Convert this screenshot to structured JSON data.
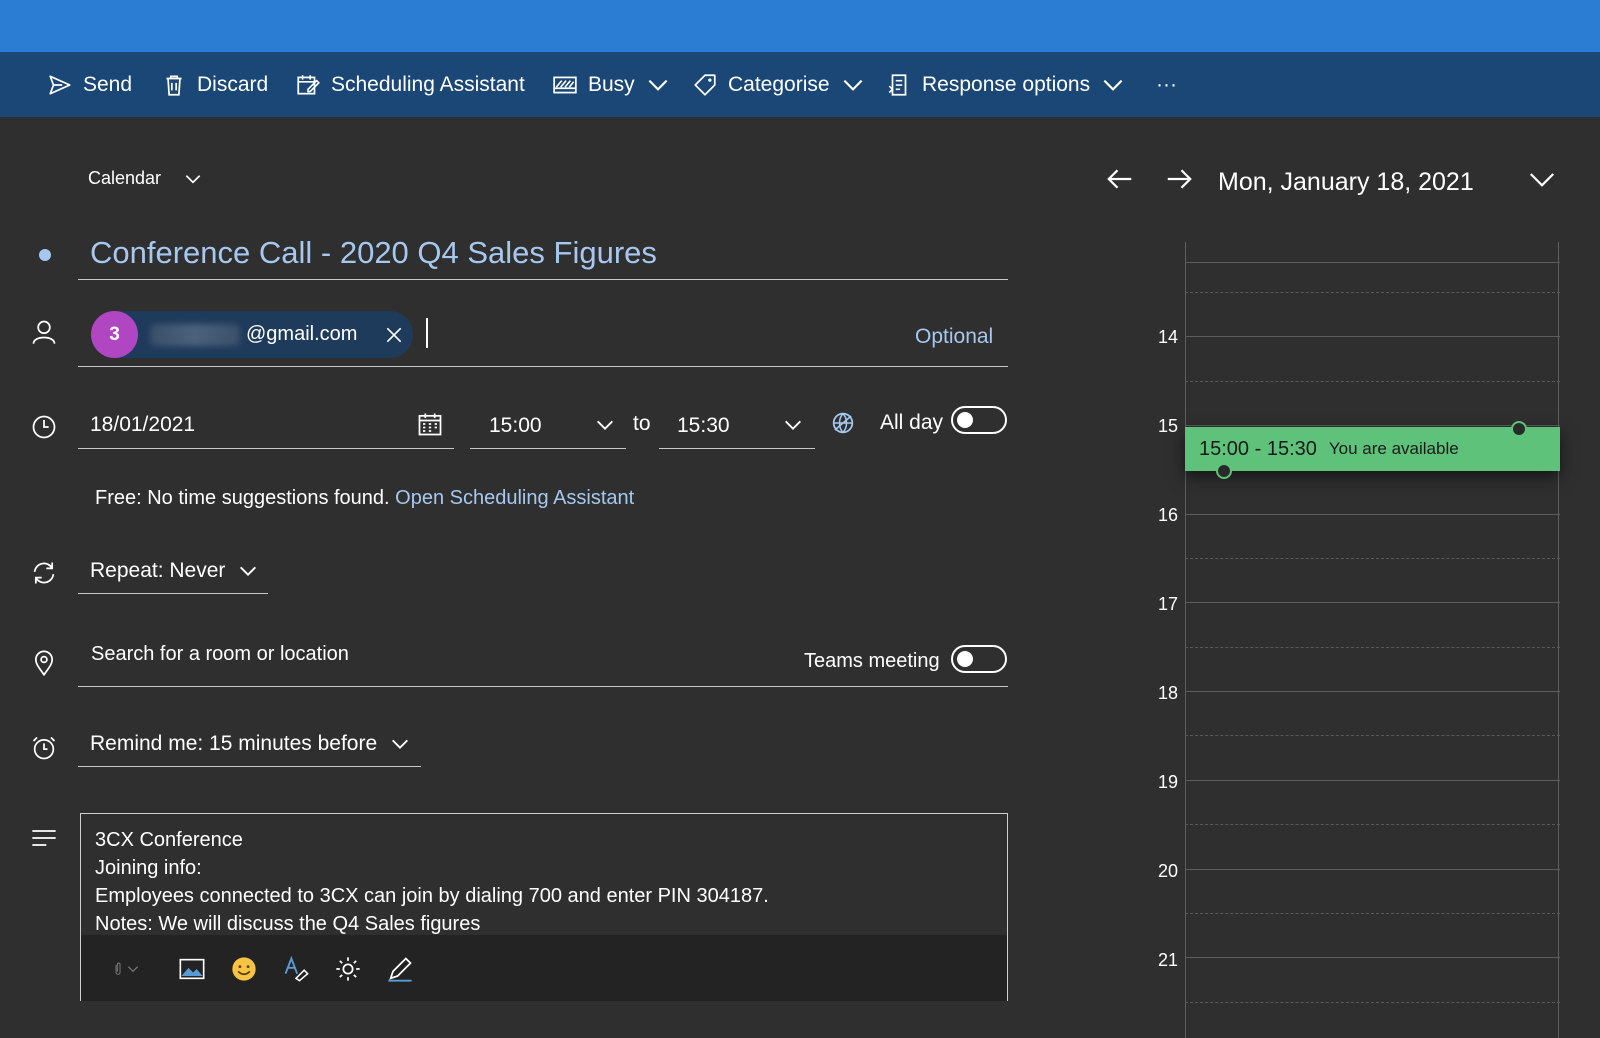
{
  "toolbar": {
    "send": "Send",
    "discard": "Discard",
    "scheduling_assistant": "Scheduling Assistant",
    "busy": "Busy",
    "categorise": "Categorise",
    "response_options": "Response options",
    "more": "···"
  },
  "calendar_selector": "Calendar",
  "event_title": "Conference Call - 2020 Q4 Sales Figures",
  "attendees": {
    "chip_count": "3",
    "chip_email": "@gmail.com",
    "optional_label": "Optional"
  },
  "date_time": {
    "date": "18/01/2021",
    "start": "15:00",
    "to_label": "to",
    "end": "15:30",
    "all_day_label": "All day"
  },
  "suggestions": {
    "text": "Free: No time suggestions found.",
    "link": "Open Scheduling Assistant"
  },
  "repeat": "Repeat:  Never",
  "location": {
    "placeholder": "Search for a room or location",
    "teams_label": "Teams meeting"
  },
  "reminder": "Remind me:  15 minutes before",
  "body_lines": [
    "3CX Conference",
    "Joining info:",
    "Employees connected to 3CX can join by dialing 700 and enter PIN 304187.",
    "Notes: We will discuss the Q4 Sales figures"
  ],
  "day_view": {
    "date": "Mon, January 18, 2021",
    "hours": [
      "14",
      "15",
      "16",
      "17",
      "18",
      "19",
      "20",
      "21"
    ],
    "event_time": "15:00 - 15:30",
    "event_status": "You are available"
  },
  "colors": {
    "titlebar": "#2b7cd3",
    "toolbar": "#1b4777",
    "background": "#2f2f2f",
    "accent_link": "#a6c8ef",
    "event_green": "#5ec27a",
    "avatar_purple": "#b146c2"
  }
}
